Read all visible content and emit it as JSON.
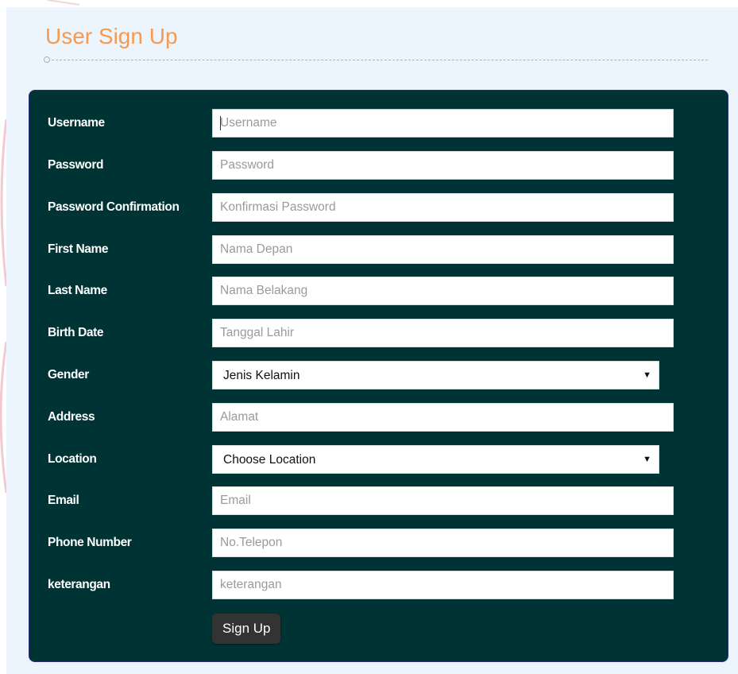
{
  "header": {
    "title": "User Sign Up"
  },
  "colors": {
    "title": "#f59a50",
    "panel_background": "#ecf5fd",
    "form_background": "#003333",
    "button_background": "#333333"
  },
  "form": {
    "fields": [
      {
        "label": "Username",
        "placeholder": "Username",
        "type": "input",
        "value": "",
        "focused": true
      },
      {
        "label": "Password",
        "placeholder": "Password",
        "type": "password",
        "value": ""
      },
      {
        "label": "Password Confirmation",
        "placeholder": "Konfirmasi Password",
        "type": "password",
        "value": ""
      },
      {
        "label": "First Name",
        "placeholder": "Nama Depan",
        "type": "input",
        "value": ""
      },
      {
        "label": "Last Name",
        "placeholder": "Nama Belakang",
        "type": "input",
        "value": ""
      },
      {
        "label": "Birth Date",
        "placeholder": "Tanggal Lahir",
        "type": "input",
        "value": ""
      },
      {
        "label": "Gender",
        "selected": "Jenis Kelamin",
        "type": "select"
      },
      {
        "label": "Address",
        "placeholder": "Alamat",
        "type": "input",
        "value": ""
      },
      {
        "label": "Location",
        "selected": "Choose Location",
        "type": "select"
      },
      {
        "label": "Email",
        "placeholder": "Email",
        "type": "input",
        "value": ""
      },
      {
        "label": "Phone Number",
        "placeholder": "No.Telepon",
        "type": "input",
        "value": ""
      },
      {
        "label": "keterangan",
        "placeholder": "keterangan",
        "type": "input",
        "value": ""
      }
    ],
    "caret_glyph": "▼",
    "submit_label": "Sign Up"
  }
}
